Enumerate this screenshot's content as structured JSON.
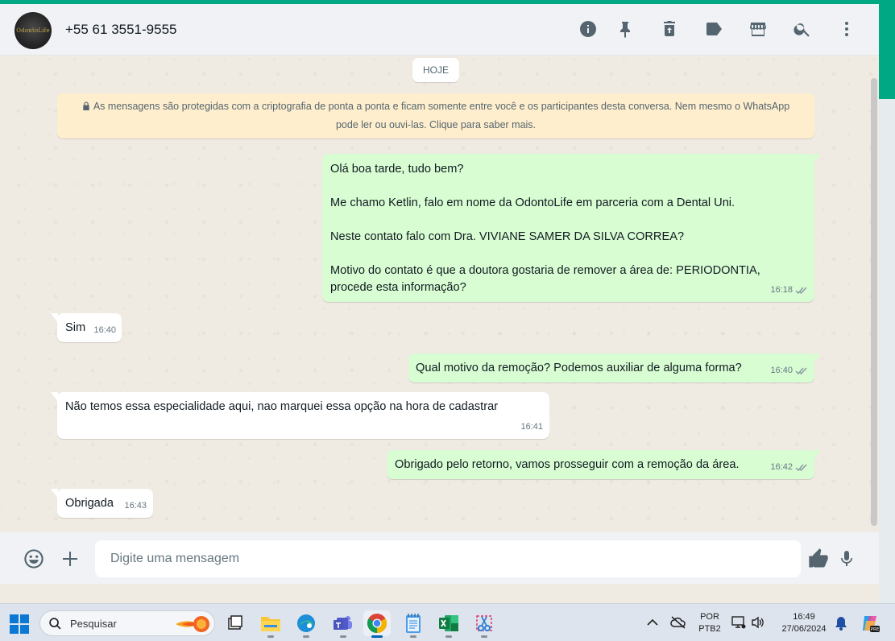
{
  "header": {
    "avatar_logo": "OdontoLife",
    "contact_name": "+55 61 3551-9555",
    "icons": [
      "info-icon",
      "pin-icon",
      "delete-icon",
      "label-icon",
      "catalog-icon",
      "search-icon",
      "menu-icon"
    ]
  },
  "chat": {
    "day_chip": "HOJE",
    "encryption_notice": "As mensagens são protegidas com a criptografia de ponta a ponta e ficam somente entre você e os participantes desta conversa. Nem mesmo o WhatsApp pode ler ou ouvi-las. Clique para saber mais.",
    "messages": [
      {
        "direction": "outgoing",
        "paragraphs": [
          "Olá boa tarde, tudo bem?",
          "Me chamo Ketlin, falo em nome da OdontoLife em parceria com a Dental Uni.",
          "Neste contato falo com Dra. VIVIANE SAMER DA SILVA CORREA?",
          "Motivo do contato é que a doutora gostaria de remover a área de: PERIODONTIA, procede esta informação?"
        ],
        "time": "16:18",
        "status": "read"
      },
      {
        "direction": "incoming",
        "text": "Sim",
        "time": "16:40"
      },
      {
        "direction": "outgoing",
        "text": "Qual motivo da remoção? Podemos auxiliar de alguma forma?",
        "time": "16:40",
        "status": "read"
      },
      {
        "direction": "incoming",
        "text": "Não temos essa especialidade aqui, nao marquei essa opção na hora de cadastrar",
        "time": "16:41"
      },
      {
        "direction": "outgoing",
        "text": "Obrigado pelo retorno, vamos prosseguir com a remoção da área.",
        "time": "16:42",
        "status": "read"
      },
      {
        "direction": "incoming",
        "text": "Obrigada",
        "time": "16:43"
      }
    ]
  },
  "composer": {
    "placeholder": "Digite uma mensagem",
    "icons": [
      "emoji-icon",
      "attach-icon",
      "thumbs-up-icon",
      "microphone-icon"
    ]
  },
  "taskbar": {
    "search_placeholder": "Pesquisar",
    "apps": [
      "task-view",
      "file-explorer",
      "edge",
      "teams",
      "chrome",
      "notepad",
      "excel",
      "snipping-tool"
    ],
    "active_app": "chrome",
    "language_line1": "POR",
    "language_line2": "PTB2",
    "time": "16:49",
    "date": "27/06/2024"
  },
  "colors": {
    "accent": "#00a884",
    "outgoing_bubble": "#d9fdd3",
    "incoming_bubble": "#ffffff",
    "chat_bg": "#efeae2",
    "encryption_bg": "#ffeecd",
    "read_ticks": "#8696a0"
  }
}
